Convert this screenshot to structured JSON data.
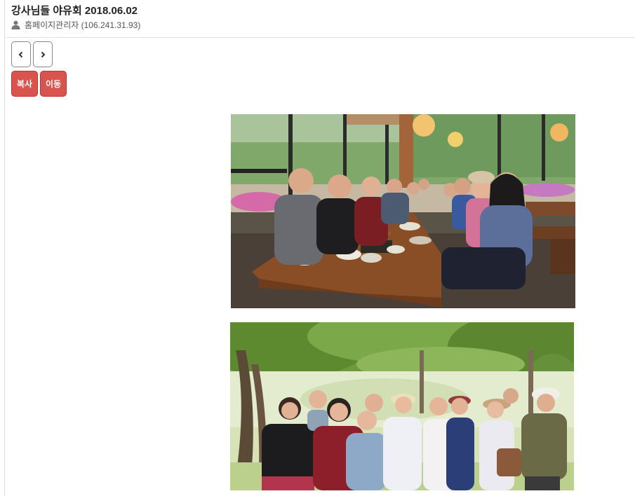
{
  "post": {
    "title": "강사님들 야유회 2018.06.02",
    "author": "홈페이지관리자 (106.241.31.93)"
  },
  "navigation": {
    "prev_icon": "chevron-left-icon",
    "next_icon": "chevron-right-icon"
  },
  "actions": {
    "copy_label": "복사",
    "move_label": "이동"
  },
  "icons": {
    "author": "user-icon"
  },
  "colors": {
    "action_button": "#d9534f",
    "divider": "#dddddd"
  }
}
